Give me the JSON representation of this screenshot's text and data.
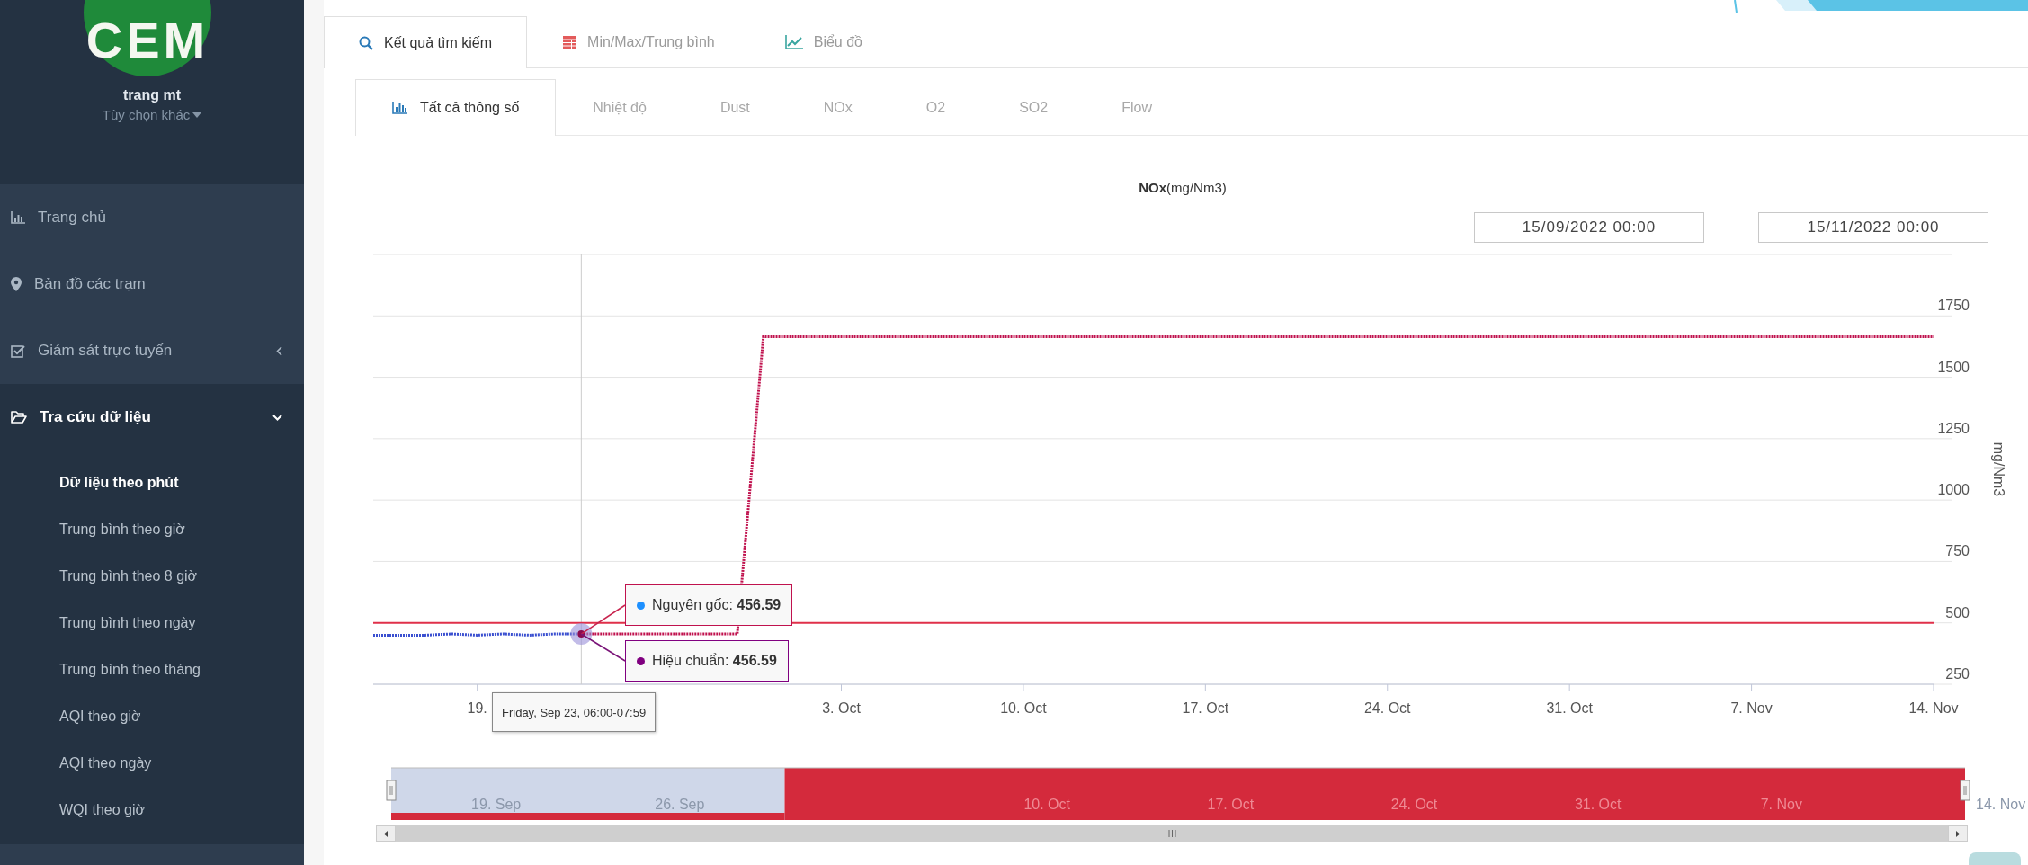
{
  "sidebar": {
    "logo": "CEM",
    "user": {
      "name": "trang mt",
      "options": "Tùy chọn khác"
    },
    "menu": [
      {
        "label": "Trang chủ",
        "kind": "link"
      },
      {
        "label": "Bản đồ các trạm",
        "kind": "link"
      },
      {
        "label": "Giám sát trực tuyến",
        "kind": "group",
        "expanded": false
      },
      {
        "label": "Tra cứu dữ liệu",
        "kind": "group",
        "expanded": true,
        "children": [
          {
            "label": "Dữ liệu theo phút",
            "selected": true
          },
          {
            "label": "Trung bình theo giờ",
            "selected": false
          },
          {
            "label": "Trung bình theo 8 giờ",
            "selected": false
          },
          {
            "label": "Trung bình theo ngày",
            "selected": false
          },
          {
            "label": "Trung bình theo tháng",
            "selected": false
          },
          {
            "label": "AQI theo giờ",
            "selected": false
          },
          {
            "label": "AQI theo ngày",
            "selected": false
          },
          {
            "label": "WQI theo giờ",
            "selected": false
          }
        ]
      }
    ]
  },
  "tabs": [
    {
      "label": "Kết quả tìm kiếm",
      "selected": true
    },
    {
      "label": "Min/Max/Trung bình",
      "selected": false
    },
    {
      "label": "Biểu đồ",
      "selected": false
    }
  ],
  "subtabs": [
    {
      "label": "Tất cả thông số",
      "selected": true
    },
    {
      "label": "Nhiệt độ",
      "selected": false
    },
    {
      "label": "Dust",
      "selected": false
    },
    {
      "label": "NOx",
      "selected": false
    },
    {
      "label": "O2",
      "selected": false
    },
    {
      "label": "SO2",
      "selected": false
    },
    {
      "label": "Flow",
      "selected": false
    }
  ],
  "chart": {
    "title": "**NOx**(mg/Nm3)",
    "date_from": "15/09/2022 00:00",
    "date_to": "15/11/2022 00:00",
    "chart_data": {
      "type": "line",
      "ylabel": "mg/Nm3",
      "categories": [
        null,
        null,
        null,
        null,
        "19.",
        null,
        null,
        null,
        null,
        null,
        null,
        null,
        null,
        null,
        null,
        null,
        null,
        null,
        "3. Oct",
        null,
        null,
        null,
        null,
        null,
        null,
        "10. Oct",
        null,
        null,
        null,
        null,
        null,
        null,
        "17. Oct",
        null,
        null,
        null,
        null,
        null,
        null,
        "24. Oct",
        null,
        null,
        null,
        null,
        null,
        null,
        "31. Oct",
        null,
        null,
        null,
        null,
        null,
        null,
        "7. Nov",
        null,
        null,
        null,
        null,
        null,
        null,
        "14. Nov"
      ],
      "series": [
        {
          "name": "Nguyên gốc",
          "color": "#3a4fd0",
          "line_style": "dotted",
          "values": [
            450,
            450,
            450,
            455,
            450,
            455,
            450,
            455,
            455,
            null,
            null,
            null,
            null,
            null,
            null,
            null,
            null,
            null,
            null,
            null,
            null,
            null,
            null,
            null,
            null,
            null,
            null,
            null,
            null,
            null,
            null,
            null,
            null,
            null,
            null,
            null,
            null,
            null,
            null,
            null,
            null,
            null,
            null,
            null,
            null,
            null,
            null,
            null,
            null,
            null,
            null,
            null,
            null,
            null,
            null,
            null,
            null,
            null,
            null,
            null,
            null
          ]
        },
        {
          "name": "Hiệu chuẩn",
          "color": "#c0124e",
          "line_style": "dotted",
          "values": [
            null,
            null,
            null,
            null,
            null,
            null,
            null,
            null,
            455,
            455,
            455,
            455,
            455,
            455,
            455,
            1665,
            1665,
            1665,
            1665,
            1665,
            1665,
            1665,
            1665,
            1665,
            1665,
            1665,
            1665,
            1665,
            1665,
            1665,
            1665,
            1665,
            1665,
            1665,
            1665,
            1665,
            1665,
            1665,
            1665,
            1665,
            1665,
            1665,
            1665,
            1665,
            1665,
            1665,
            1665,
            1665,
            1665,
            1665,
            1665,
            1665,
            1665,
            1665,
            1665,
            1665,
            1665,
            1665,
            1665,
            1665,
            1665
          ]
        }
      ],
      "ylim": [
        250,
        2000
      ],
      "grid": true,
      "yticks": [
        250,
        500,
        750,
        1000,
        1250,
        1500,
        1750
      ],
      "ref_lines": [
        {
          "axis": "y",
          "value": 500
        }
      ]
    },
    "tooltip": {
      "header": "Friday, Sep 23, 06:00-07:59",
      "separator": ":",
      "items": [
        {
          "value": "456.59",
          "color": "#1e90ff"
        },
        {
          "value": "456.59",
          "color": "#800080"
        }
      ]
    },
    "navigator": {
      "labels": [
        "19. Sep",
        "26. Sep",
        "10. Oct",
        "17. Oct",
        "24. Oct",
        "31. Oct",
        "7. Nov",
        "14. Nov"
      ]
    }
  }
}
